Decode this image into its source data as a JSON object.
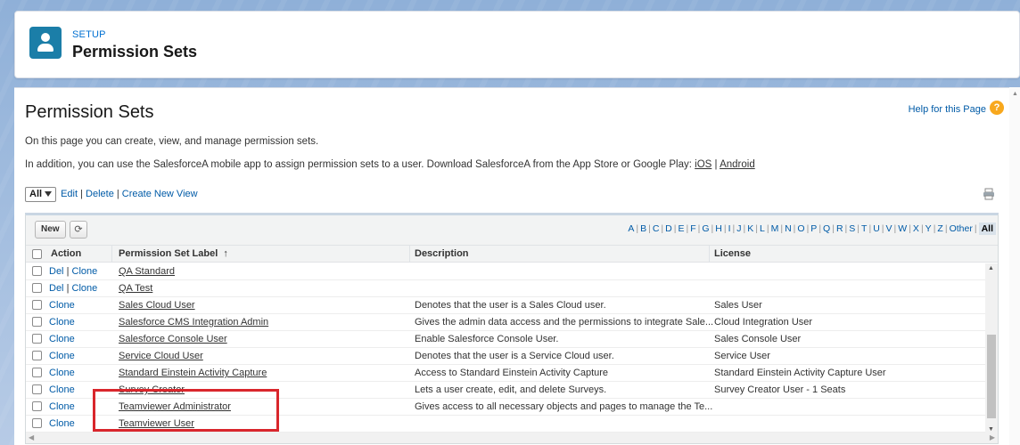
{
  "header": {
    "eyebrow": "SETUP",
    "title": "Permission Sets"
  },
  "page": {
    "title": "Permission Sets",
    "help_link": "Help for this Page",
    "help_icon": "?",
    "description_1": "On this page you can create, view, and manage permission sets.",
    "description_2": "In addition, you can use the SalesforceA mobile app to assign permission sets to a user. Download SalesforceA from the App Store or Google Play:",
    "ios_link": "iOS",
    "separator": "|",
    "android_link": "Android"
  },
  "view": {
    "selected": "All",
    "edit": "Edit",
    "delete": "Delete",
    "create": "Create New View",
    "sep": "|"
  },
  "toolbar": {
    "new_label": "New",
    "refresh_icon": "⟳"
  },
  "alphabet": [
    "A",
    "B",
    "C",
    "D",
    "E",
    "F",
    "G",
    "H",
    "I",
    "J",
    "K",
    "L",
    "M",
    "N",
    "O",
    "P",
    "Q",
    "R",
    "S",
    "T",
    "U",
    "V",
    "W",
    "X",
    "Y",
    "Z",
    "Other",
    "All"
  ],
  "columns": {
    "action": "Action",
    "label": "Permission Set Label",
    "sort_arrow": "↑",
    "description": "Description",
    "license": "License"
  },
  "rows": [
    {
      "del": "Del",
      "clone": "Clone",
      "label": "QA Standard",
      "description": "",
      "license": ""
    },
    {
      "del": "Del",
      "clone": "Clone",
      "label": "QA Test",
      "description": "",
      "license": ""
    },
    {
      "del": "",
      "clone": "Clone",
      "label": "Sales Cloud User",
      "description": "Denotes that the user is a Sales Cloud user.",
      "license": "Sales User"
    },
    {
      "del": "",
      "clone": "Clone",
      "label": "Salesforce CMS Integration Admin",
      "description": "Gives the admin data access and the permissions to integrate Sale...",
      "license": "Cloud Integration User"
    },
    {
      "del": "",
      "clone": "Clone",
      "label": "Salesforce Console User",
      "description": "Enable Salesforce Console User.",
      "license": "Sales Console User"
    },
    {
      "del": "",
      "clone": "Clone",
      "label": "Service Cloud User",
      "description": "Denotes that the user is a Service Cloud user.",
      "license": "Service User"
    },
    {
      "del": "",
      "clone": "Clone",
      "label": "Standard Einstein Activity Capture",
      "description": "Access to Standard Einstein Activity Capture",
      "license": "Standard Einstein Activity Capture User"
    },
    {
      "del": "",
      "clone": "Clone",
      "label": "Survey Creator",
      "description": "Lets a user create, edit, and delete Surveys.",
      "license": "Survey Creator User - 1 Seats"
    },
    {
      "del": "",
      "clone": "Clone",
      "label": "Teamviewer Administrator",
      "description": "Gives access to all necessary objects and pages to manage the Te...",
      "license": ""
    },
    {
      "del": "",
      "clone": "Clone",
      "label": "Teamviewer User",
      "description": "",
      "license": ""
    }
  ],
  "colors": {
    "link": "#015ba7",
    "brand_icon": "#1b7ea8",
    "highlight": "#d9262c"
  }
}
